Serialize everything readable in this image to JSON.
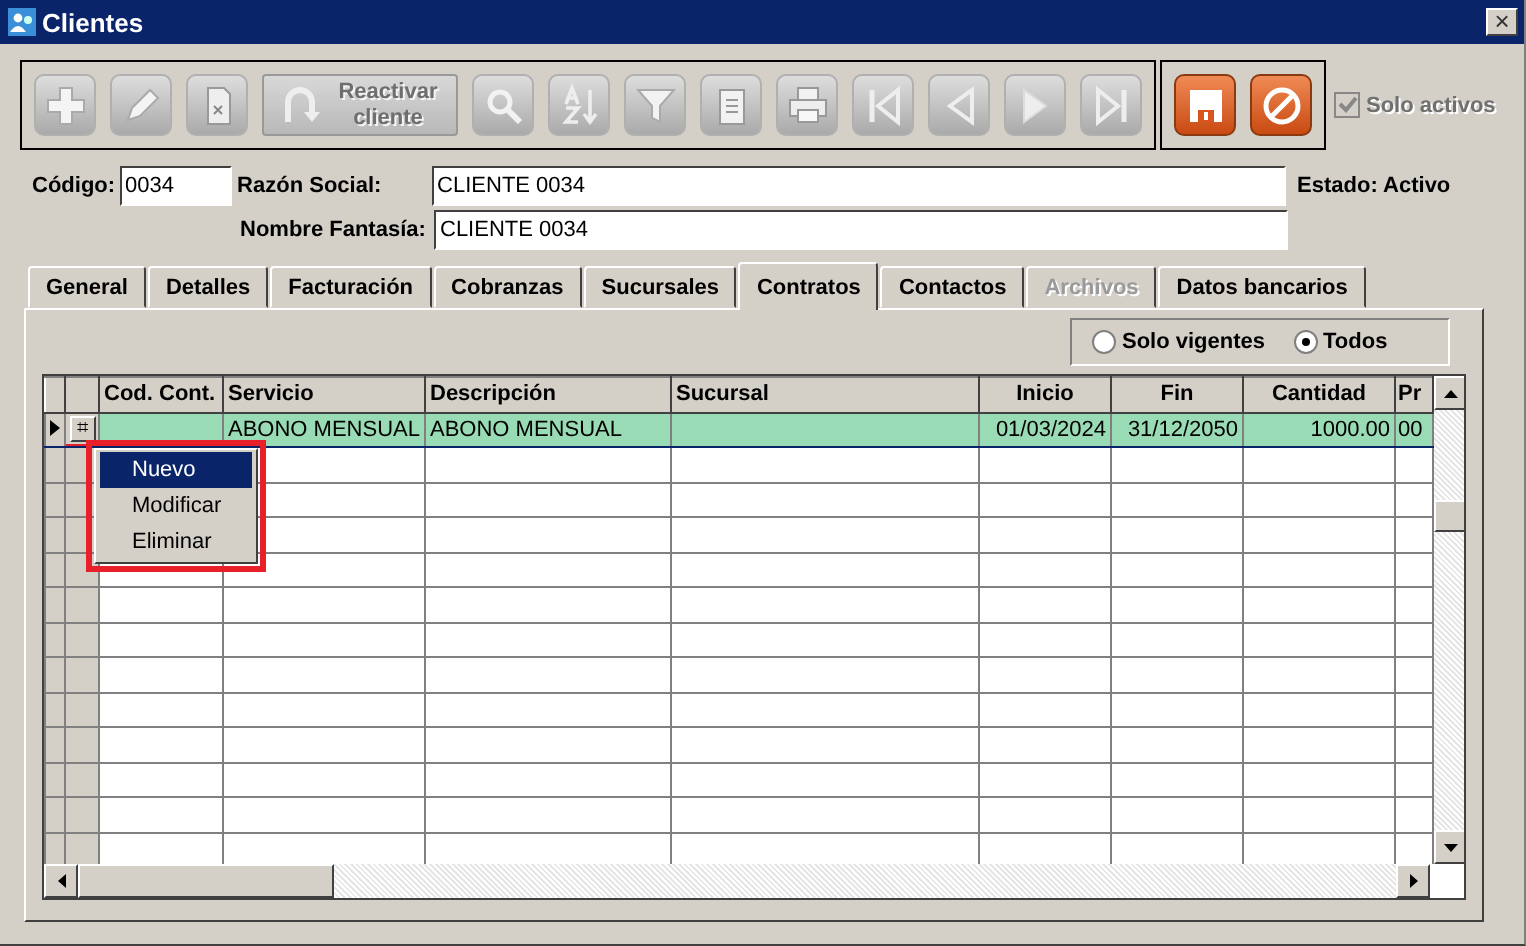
{
  "window": {
    "title": "Clientes",
    "close": "×"
  },
  "toolbar": {
    "groups": [
      {
        "buttons": [
          {
            "kind": "add",
            "disabled": true
          },
          {
            "kind": "edit",
            "disabled": true
          },
          {
            "kind": "delete",
            "disabled": true
          },
          {
            "kind": "reactivate",
            "label": "Reactivar cliente",
            "disabled": true
          },
          {
            "kind": "search",
            "disabled": true
          },
          {
            "kind": "sort",
            "disabled": true
          },
          {
            "kind": "filter",
            "disabled": true
          },
          {
            "kind": "clipboard",
            "disabled": true
          },
          {
            "kind": "print",
            "disabled": true
          },
          {
            "kind": "first",
            "disabled": true
          },
          {
            "kind": "prev",
            "disabled": true
          },
          {
            "kind": "next",
            "disabled": true
          },
          {
            "kind": "last",
            "disabled": true
          }
        ]
      },
      {
        "buttons": [
          {
            "kind": "save",
            "disabled": false
          },
          {
            "kind": "cancel",
            "disabled": false
          }
        ]
      }
    ],
    "solo_activos": {
      "label": "Solo activos",
      "checked": true,
      "disabled": true
    }
  },
  "form": {
    "codigo": {
      "label": "Código:",
      "value": "0034"
    },
    "razon_social": {
      "label": "Razón Social:",
      "value": "CLIENTE 0034"
    },
    "estado": "Estado: Activo",
    "nombre_fantasia": {
      "label": "Nombre Fantasía:",
      "value": "CLIENTE 0034"
    }
  },
  "tabs": [
    {
      "label": "General",
      "selected": false,
      "disabled": false
    },
    {
      "label": "Detalles",
      "selected": false,
      "disabled": false
    },
    {
      "label": "Facturación",
      "selected": false,
      "disabled": false
    },
    {
      "label": "Cobranzas",
      "selected": false,
      "disabled": false
    },
    {
      "label": "Sucursales",
      "selected": false,
      "disabled": false
    },
    {
      "label": "Contratos",
      "selected": true,
      "disabled": false
    },
    {
      "label": "Contactos",
      "selected": false,
      "disabled": false
    },
    {
      "label": "Archivos",
      "selected": false,
      "disabled": true
    },
    {
      "label": "Datos bancarios",
      "selected": false,
      "disabled": false
    }
  ],
  "filter": [
    {
      "label": "Solo vigentes",
      "selected": false
    },
    {
      "label": "Todos",
      "selected": true
    }
  ],
  "table": {
    "columns": [
      "Cod. Cont.",
      "Servicio",
      "Descripción",
      "Sucursal",
      "Inicio",
      "Fin",
      "Cantidad",
      "Pr"
    ],
    "rows": [
      {
        "selected": true,
        "button": "⌗",
        "button_highlighted": true,
        "cells": [
          "",
          "ABONO MENSUAL",
          "ABONO MENSUAL",
          "",
          "01/03/2024",
          "31/12/2050",
          "1000.00",
          "00"
        ]
      }
    ]
  },
  "context_menu": {
    "highlighted": true,
    "items": [
      {
        "label": "Nuevo",
        "selected": true
      },
      {
        "label": "Modificar",
        "selected": false
      },
      {
        "label": "Eliminar",
        "selected": false
      }
    ]
  }
}
